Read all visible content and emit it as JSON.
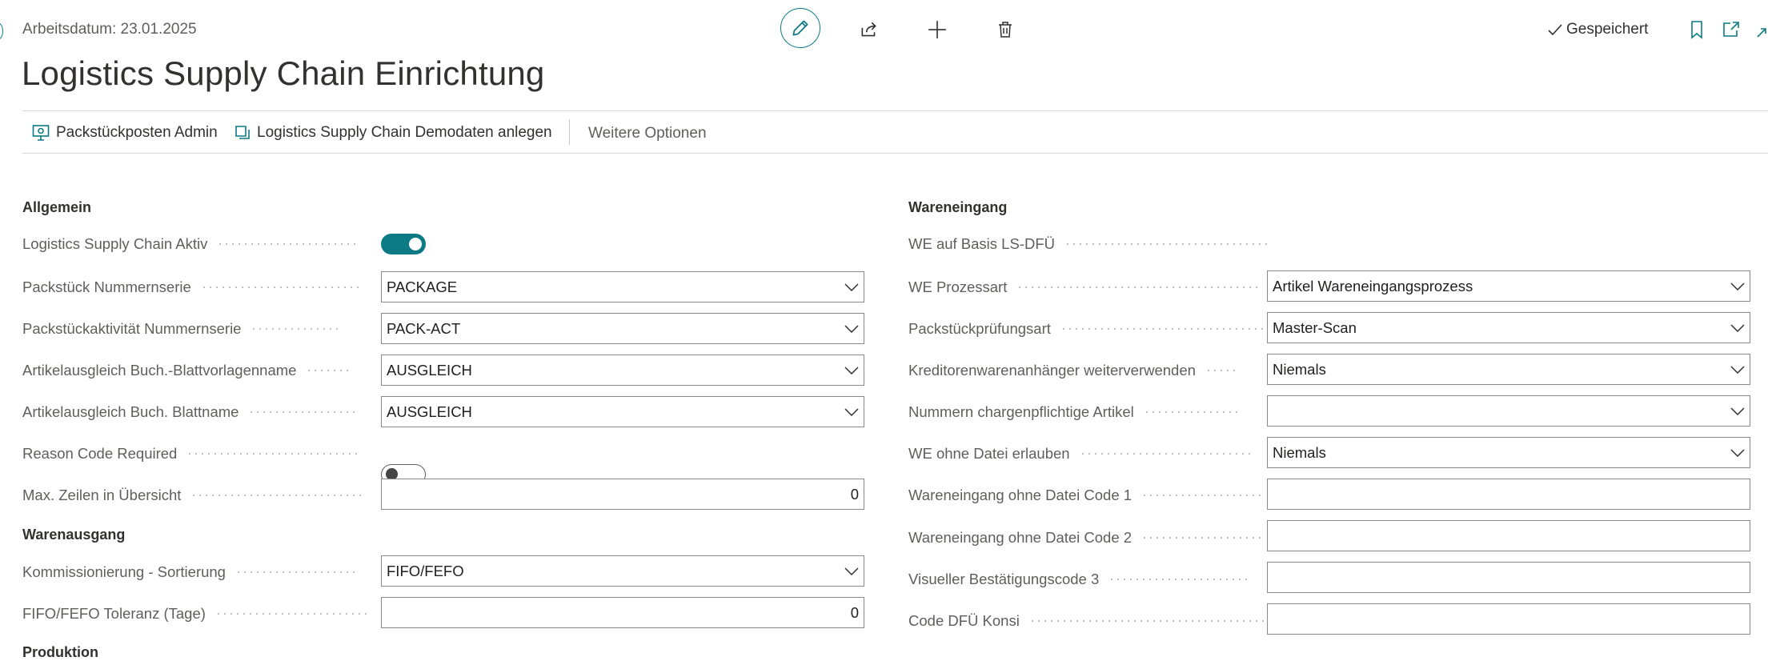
{
  "header": {
    "workdate": "Arbeitsdatum: 23.01.2025",
    "title": "Logistics Supply Chain Einrichtung",
    "saved_label": "Gespeichert",
    "icons": [
      "edit-icon",
      "share-icon",
      "plus-icon",
      "delete-icon",
      "bookmark-icon",
      "open-new-window-icon",
      "collapse-icon"
    ]
  },
  "actions": {
    "package_admin": "Packstückposten Admin",
    "demo_data": "Logistics Supply Chain Demodaten anlegen",
    "more_options": "Weitere Optionen"
  },
  "general": {
    "heading": "Allgemein",
    "lsc_active": {
      "label": "Logistics Supply Chain Aktiv",
      "value": true
    },
    "package_series": {
      "label": "Packstück Nummernserie",
      "value": "PACKAGE"
    },
    "package_activity_series": {
      "label": "Packstückaktivität Nummernserie",
      "value": "PACK-ACT"
    },
    "item_adj_template": {
      "label": "Artikelausgleich Buch.-Blattvorlagenname",
      "value": "AUSGLEICH"
    },
    "item_adj_batch": {
      "label": "Artikelausgleich Buch. Blattname",
      "value": "AUSGLEICH"
    },
    "reason_code_required": {
      "label": "Reason Code Required",
      "value": false
    },
    "max_lines": {
      "label": "Max. Zeilen in Übersicht",
      "value": "0"
    }
  },
  "outbound": {
    "heading": "Warenausgang",
    "picking_sort": {
      "label": "Kommissionierung - Sortierung",
      "value": "FIFO/FEFO"
    },
    "fifo_tolerance": {
      "label": "FIFO/FEFO Toleranz (Tage)",
      "value": "0"
    }
  },
  "production": {
    "heading": "Produktion"
  },
  "inbound": {
    "heading": "Wareneingang",
    "we_basis": {
      "label": "WE auf Basis LS-DFÜ",
      "value": true
    },
    "we_process": {
      "label": "WE Prozessart",
      "value": "Artikel Wareneingangsprozess"
    },
    "package_check": {
      "label": "Packstückprüfungsart",
      "value": "Master-Scan"
    },
    "vendor_trailer": {
      "label": "Kreditorenwarenanhänger weiterverwenden",
      "value": "Niemals"
    },
    "batch_numbers": {
      "label": "Nummern chargenpflichtige Artikel",
      "value": ""
    },
    "we_without_file": {
      "label": "WE ohne Datei erlauben",
      "value": "Niemals"
    },
    "no_file_code1": {
      "label": "Wareneingang ohne Datei Code 1",
      "value": ""
    },
    "no_file_code2": {
      "label": "Wareneingang ohne Datei Code 2",
      "value": ""
    },
    "visual_code3": {
      "label": "Visueller Bestätigungscode 3",
      "value": ""
    },
    "code_dfu_konsi": {
      "label": "Code DFÜ Konsi",
      "value": ""
    }
  },
  "colors": {
    "accent": "#0b7a84",
    "text": "#323130",
    "label": "#605e5c",
    "border": "#8a8886"
  }
}
